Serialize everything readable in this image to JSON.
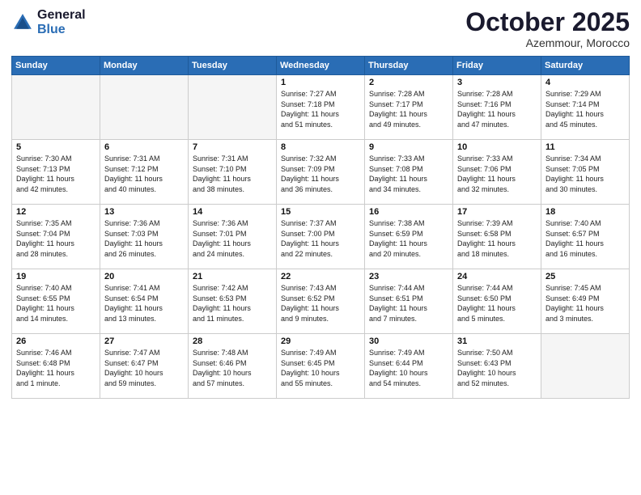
{
  "logo": {
    "line1": "General",
    "line2": "Blue"
  },
  "title": "October 2025",
  "location": "Azemmour, Morocco",
  "weekdays": [
    "Sunday",
    "Monday",
    "Tuesday",
    "Wednesday",
    "Thursday",
    "Friday",
    "Saturday"
  ],
  "weeks": [
    [
      {
        "day": "",
        "info": ""
      },
      {
        "day": "",
        "info": ""
      },
      {
        "day": "",
        "info": ""
      },
      {
        "day": "1",
        "info": "Sunrise: 7:27 AM\nSunset: 7:18 PM\nDaylight: 11 hours\nand 51 minutes."
      },
      {
        "day": "2",
        "info": "Sunrise: 7:28 AM\nSunset: 7:17 PM\nDaylight: 11 hours\nand 49 minutes."
      },
      {
        "day": "3",
        "info": "Sunrise: 7:28 AM\nSunset: 7:16 PM\nDaylight: 11 hours\nand 47 minutes."
      },
      {
        "day": "4",
        "info": "Sunrise: 7:29 AM\nSunset: 7:14 PM\nDaylight: 11 hours\nand 45 minutes."
      }
    ],
    [
      {
        "day": "5",
        "info": "Sunrise: 7:30 AM\nSunset: 7:13 PM\nDaylight: 11 hours\nand 42 minutes."
      },
      {
        "day": "6",
        "info": "Sunrise: 7:31 AM\nSunset: 7:12 PM\nDaylight: 11 hours\nand 40 minutes."
      },
      {
        "day": "7",
        "info": "Sunrise: 7:31 AM\nSunset: 7:10 PM\nDaylight: 11 hours\nand 38 minutes."
      },
      {
        "day": "8",
        "info": "Sunrise: 7:32 AM\nSunset: 7:09 PM\nDaylight: 11 hours\nand 36 minutes."
      },
      {
        "day": "9",
        "info": "Sunrise: 7:33 AM\nSunset: 7:08 PM\nDaylight: 11 hours\nand 34 minutes."
      },
      {
        "day": "10",
        "info": "Sunrise: 7:33 AM\nSunset: 7:06 PM\nDaylight: 11 hours\nand 32 minutes."
      },
      {
        "day": "11",
        "info": "Sunrise: 7:34 AM\nSunset: 7:05 PM\nDaylight: 11 hours\nand 30 minutes."
      }
    ],
    [
      {
        "day": "12",
        "info": "Sunrise: 7:35 AM\nSunset: 7:04 PM\nDaylight: 11 hours\nand 28 minutes."
      },
      {
        "day": "13",
        "info": "Sunrise: 7:36 AM\nSunset: 7:03 PM\nDaylight: 11 hours\nand 26 minutes."
      },
      {
        "day": "14",
        "info": "Sunrise: 7:36 AM\nSunset: 7:01 PM\nDaylight: 11 hours\nand 24 minutes."
      },
      {
        "day": "15",
        "info": "Sunrise: 7:37 AM\nSunset: 7:00 PM\nDaylight: 11 hours\nand 22 minutes."
      },
      {
        "day": "16",
        "info": "Sunrise: 7:38 AM\nSunset: 6:59 PM\nDaylight: 11 hours\nand 20 minutes."
      },
      {
        "day": "17",
        "info": "Sunrise: 7:39 AM\nSunset: 6:58 PM\nDaylight: 11 hours\nand 18 minutes."
      },
      {
        "day": "18",
        "info": "Sunrise: 7:40 AM\nSunset: 6:57 PM\nDaylight: 11 hours\nand 16 minutes."
      }
    ],
    [
      {
        "day": "19",
        "info": "Sunrise: 7:40 AM\nSunset: 6:55 PM\nDaylight: 11 hours\nand 14 minutes."
      },
      {
        "day": "20",
        "info": "Sunrise: 7:41 AM\nSunset: 6:54 PM\nDaylight: 11 hours\nand 13 minutes."
      },
      {
        "day": "21",
        "info": "Sunrise: 7:42 AM\nSunset: 6:53 PM\nDaylight: 11 hours\nand 11 minutes."
      },
      {
        "day": "22",
        "info": "Sunrise: 7:43 AM\nSunset: 6:52 PM\nDaylight: 11 hours\nand 9 minutes."
      },
      {
        "day": "23",
        "info": "Sunrise: 7:44 AM\nSunset: 6:51 PM\nDaylight: 11 hours\nand 7 minutes."
      },
      {
        "day": "24",
        "info": "Sunrise: 7:44 AM\nSunset: 6:50 PM\nDaylight: 11 hours\nand 5 minutes."
      },
      {
        "day": "25",
        "info": "Sunrise: 7:45 AM\nSunset: 6:49 PM\nDaylight: 11 hours\nand 3 minutes."
      }
    ],
    [
      {
        "day": "26",
        "info": "Sunrise: 7:46 AM\nSunset: 6:48 PM\nDaylight: 11 hours\nand 1 minute."
      },
      {
        "day": "27",
        "info": "Sunrise: 7:47 AM\nSunset: 6:47 PM\nDaylight: 10 hours\nand 59 minutes."
      },
      {
        "day": "28",
        "info": "Sunrise: 7:48 AM\nSunset: 6:46 PM\nDaylight: 10 hours\nand 57 minutes."
      },
      {
        "day": "29",
        "info": "Sunrise: 7:49 AM\nSunset: 6:45 PM\nDaylight: 10 hours\nand 55 minutes."
      },
      {
        "day": "30",
        "info": "Sunrise: 7:49 AM\nSunset: 6:44 PM\nDaylight: 10 hours\nand 54 minutes."
      },
      {
        "day": "31",
        "info": "Sunrise: 7:50 AM\nSunset: 6:43 PM\nDaylight: 10 hours\nand 52 minutes."
      },
      {
        "day": "",
        "info": ""
      }
    ]
  ]
}
